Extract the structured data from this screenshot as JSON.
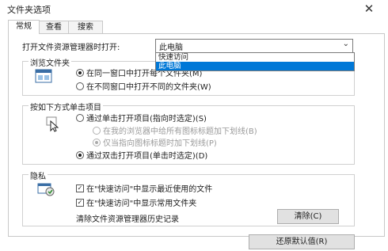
{
  "window": {
    "title": "文件夹选项",
    "close_glyph": "✕"
  },
  "tabs": [
    {
      "label": "常规",
      "active": true
    },
    {
      "label": "查看",
      "active": false
    },
    {
      "label": "搜索",
      "active": false
    }
  ],
  "open_explorer": {
    "label": "打开文件资源管理器时打开:",
    "value": "此电脑",
    "options": [
      {
        "label": "快速访问",
        "selected": false
      },
      {
        "label": "此电脑",
        "selected": true
      }
    ]
  },
  "browse": {
    "title": "浏览文件夹",
    "icon": "folder-window-icon",
    "opt1": "在同一窗口中打开每个文件夹(M)",
    "opt2": "在不同窗口中打开不同的文件夹(W)",
    "selected": 0
  },
  "click": {
    "title": "按如下方式单击项目",
    "icon": "cursor-click-icon",
    "single": "通过单击打开项目(指向时选定)(S)",
    "sub1": "在我的浏览器中给所有图标标题加下划线(B)",
    "sub2": "仅当指向图标标题时加下划线(P)",
    "double": "通过双击打开项目(单击时选定)(D)",
    "selected": "double"
  },
  "privacy": {
    "title": "隐私",
    "icon": "privacy-icon",
    "check1": "在\"快速访问\"中显示最近使用的文件",
    "check2": "在\"快速访问\"中显示常用文件夹",
    "clear_label": "清除文件资源管理器历史记录",
    "clear_button": "清除(C)"
  },
  "restore_button": "还原默认值(R)",
  "colors": {
    "accent": "#0078d7"
  }
}
